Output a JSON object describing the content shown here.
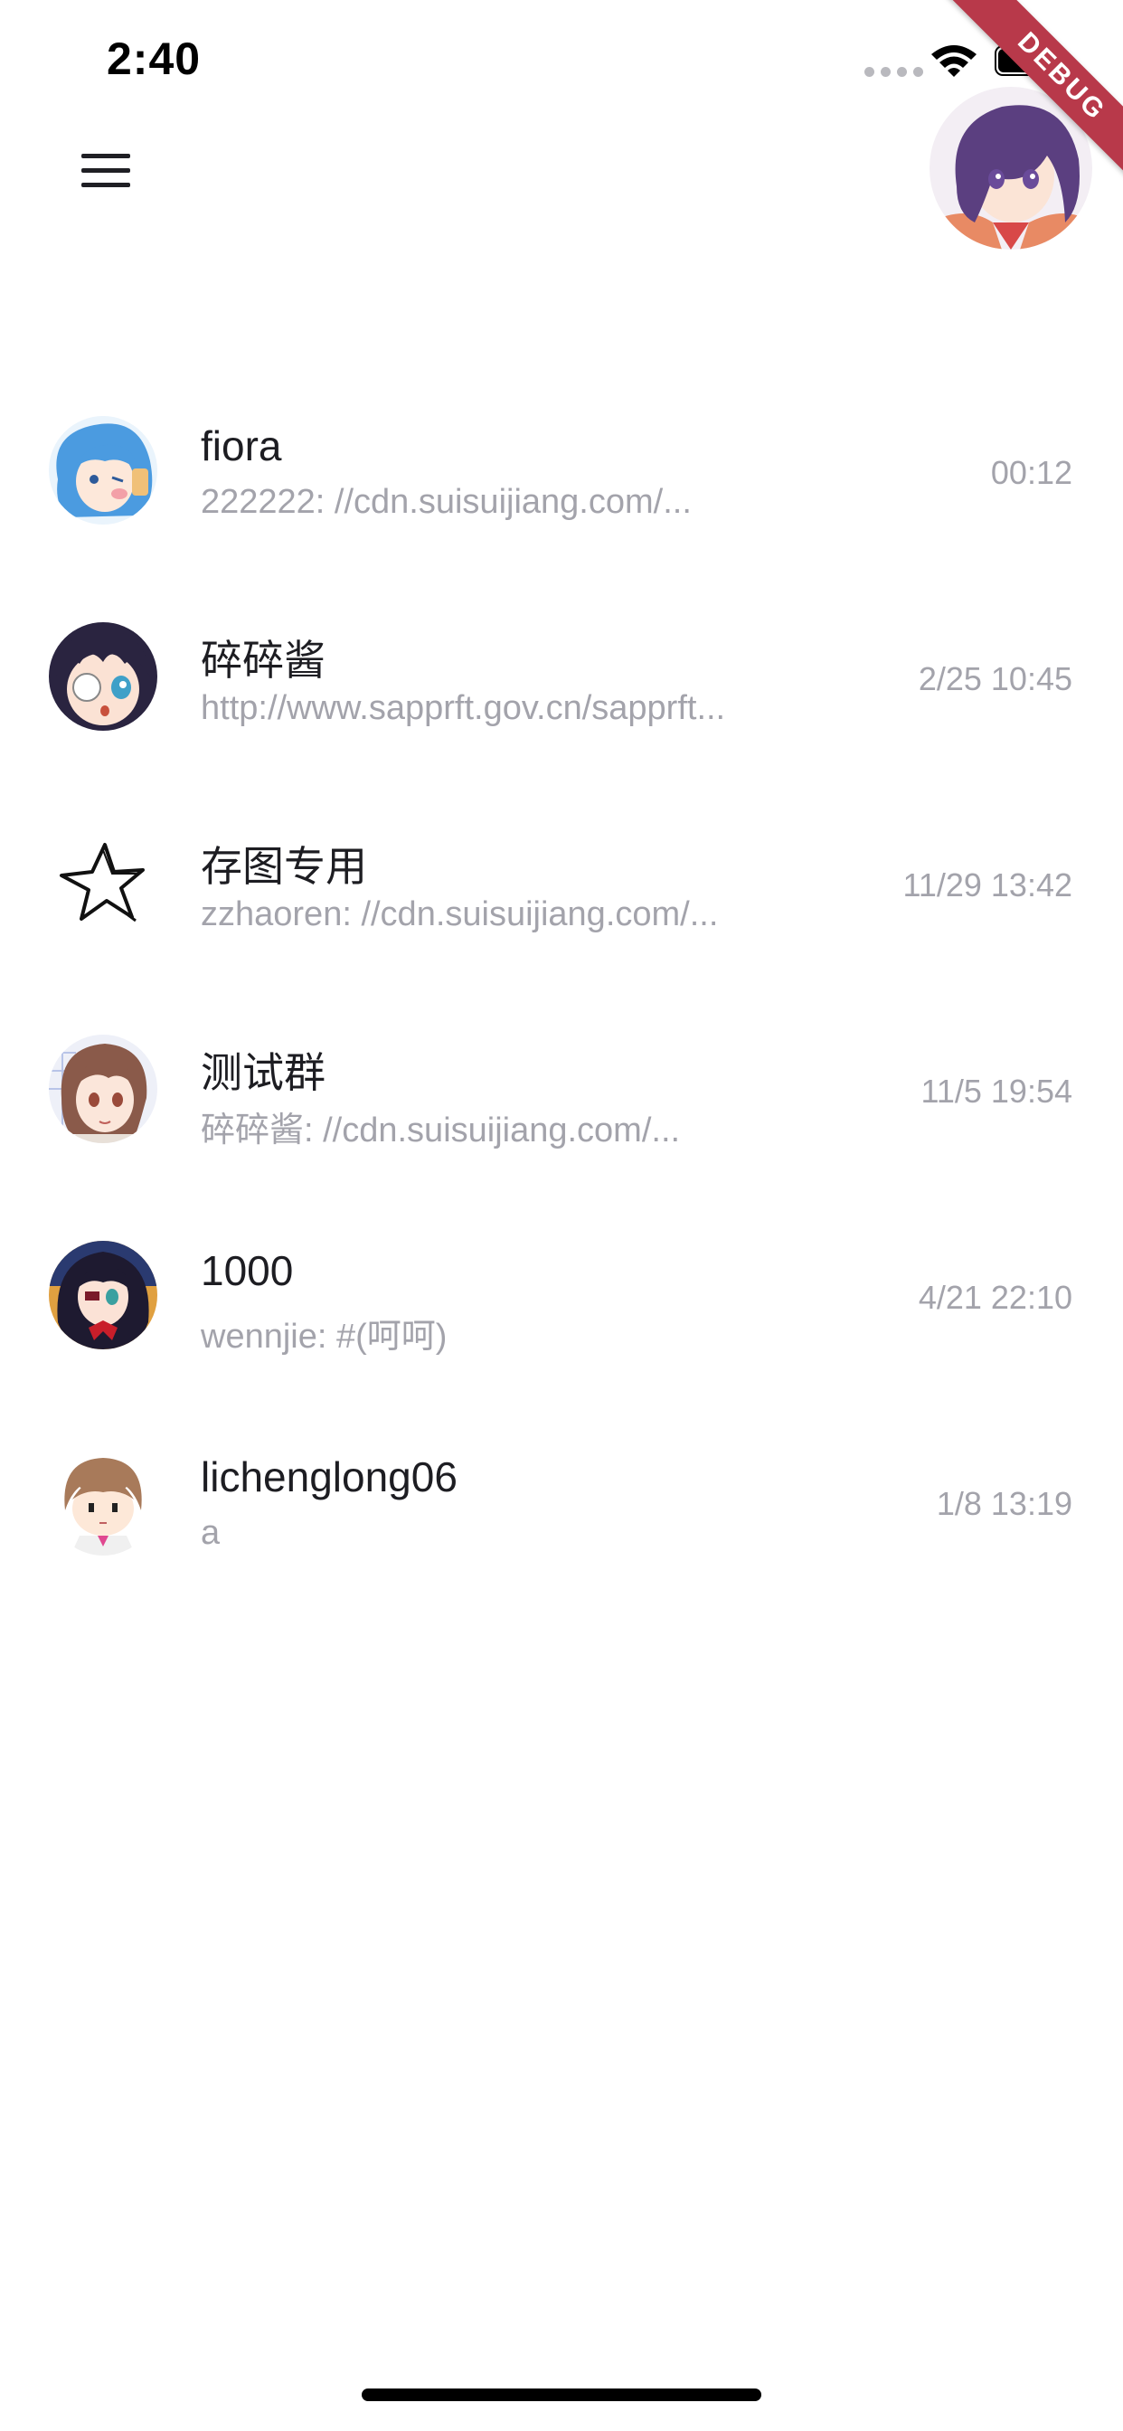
{
  "status_bar": {
    "time": "2:40"
  },
  "debug_banner": {
    "label": "DEBUG"
  },
  "app_bar": {
    "menu_icon": "hamburger-menu-icon",
    "profile_avatar": "anime-girl-purple-hair-avatar"
  },
  "chats": [
    {
      "name": "fiora",
      "preview": "222222: //cdn.suisuijiang.com/...",
      "time": "00:12",
      "avatar": "blue-hair-anime-avatar"
    },
    {
      "name": "碎碎酱",
      "preview": "http://www.sapprft.gov.cn/sapprft...",
      "time": "2/25 10:45",
      "avatar": "eyepatch-anime-avatar"
    },
    {
      "name": "存图专用",
      "preview": "zzhaoren: //cdn.suisuijiang.com/...",
      "time": "11/29 13:42",
      "avatar": "star-sketch-avatar"
    },
    {
      "name": "测试群",
      "preview": "碎碎酱: //cdn.suisuijiang.com/...",
      "time": "11/5 19:54",
      "avatar": "brown-hair-anime-avatar"
    },
    {
      "name": "1000",
      "preview": "wennjie: #(呵呵)",
      "time": "4/21 22:10",
      "avatar": "dark-hair-red-ribbon-avatar"
    },
    {
      "name": "lichenglong06",
      "preview": "a",
      "time": "1/8 13:19",
      "avatar": "chibi-brown-hair-avatar"
    }
  ],
  "colors": {
    "name_text": "#1d1d22",
    "secondary_text": "#a3a3ab",
    "debug_banner": "#b8394a"
  }
}
